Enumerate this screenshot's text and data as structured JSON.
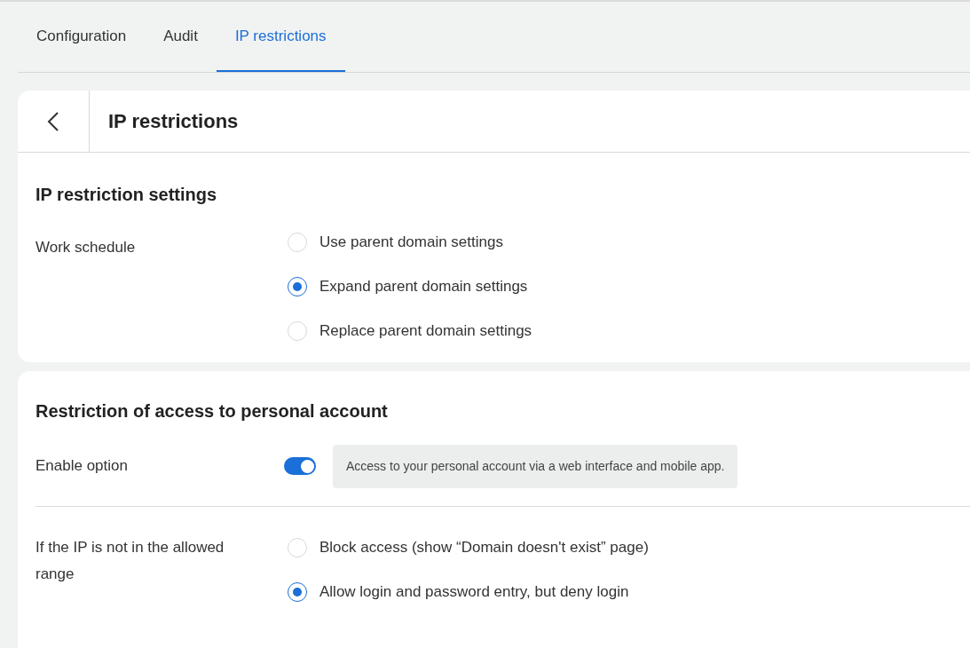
{
  "tabs": [
    {
      "label": "Configuration",
      "selected": false
    },
    {
      "label": "Audit",
      "selected": false
    },
    {
      "label": "IP restrictions",
      "selected": true
    }
  ],
  "header": {
    "title": "IP restrictions"
  },
  "settings": {
    "title": "IP restriction settings",
    "label": "Work schedule",
    "options": [
      {
        "label": "Use parent domain settings",
        "selected": false
      },
      {
        "label": "Expand parent domain settings",
        "selected": true
      },
      {
        "label": "Replace parent domain settings",
        "selected": false
      }
    ]
  },
  "access": {
    "title": "Restriction of access to personal account",
    "enable_label": "Enable option",
    "enabled": true,
    "hint": "Access to your personal account via a web interface and mobile app.",
    "range_label": "If the IP is not in the allowed range",
    "options": [
      {
        "label": "Block access (show “Domain doesn't exist” page)",
        "selected": false
      },
      {
        "label": "Allow login and password entry, but deny login",
        "selected": true
      }
    ]
  }
}
